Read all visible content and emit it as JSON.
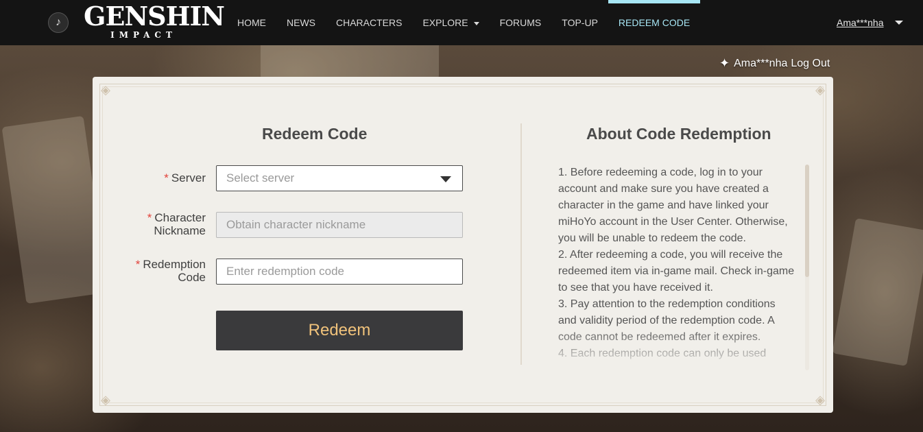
{
  "nav": {
    "logo_main": "GENSHIN",
    "logo_sub": "IMPACT",
    "items": [
      {
        "label": "HOME"
      },
      {
        "label": "NEWS"
      },
      {
        "label": "CHARACTERS"
      },
      {
        "label": "EXPLORE"
      },
      {
        "label": "FORUMS"
      },
      {
        "label": "TOP-UP"
      },
      {
        "label": "REDEEM CODE"
      }
    ],
    "active_item": "REDEEM CODE",
    "user_name": "Ama***nha"
  },
  "account_bar": {
    "user_name": "Ama***nha",
    "logout_label": "Log Out"
  },
  "redeem": {
    "title": "Redeem Code",
    "server_label": "Server",
    "server_placeholder": "Select server",
    "nickname_label_1": "Character",
    "nickname_label_2": "Nickname",
    "nickname_placeholder": "Obtain character nickname",
    "code_label_1": "Redemption",
    "code_label_2": "Code",
    "code_placeholder": "Enter redemption code",
    "required_mark": "*",
    "button_label": "Redeem"
  },
  "about": {
    "title": "About Code Redemption",
    "items": [
      "1. Before redeeming a code, log in to your account and make sure you have created a character in the game and have linked your miHoYo account in the User Center. Otherwise, you will be unable to redeem the code.",
      "2. After redeeming a code, you will receive the redeemed item via in-game mail. Check in-game to see that you have received it.",
      "3. Pay attention to the redemption conditions and validity period of the redemption code. A code cannot be redeemed after it expires.",
      "4. Each redemption code can only be used"
    ]
  },
  "colors": {
    "nav_bg": "#141414",
    "active_nav": "#a7e6f5",
    "card_bg": "#f1efea",
    "button_bg": "#3a3a3c",
    "button_text": "#f0c27b",
    "required": "#e2433b"
  }
}
